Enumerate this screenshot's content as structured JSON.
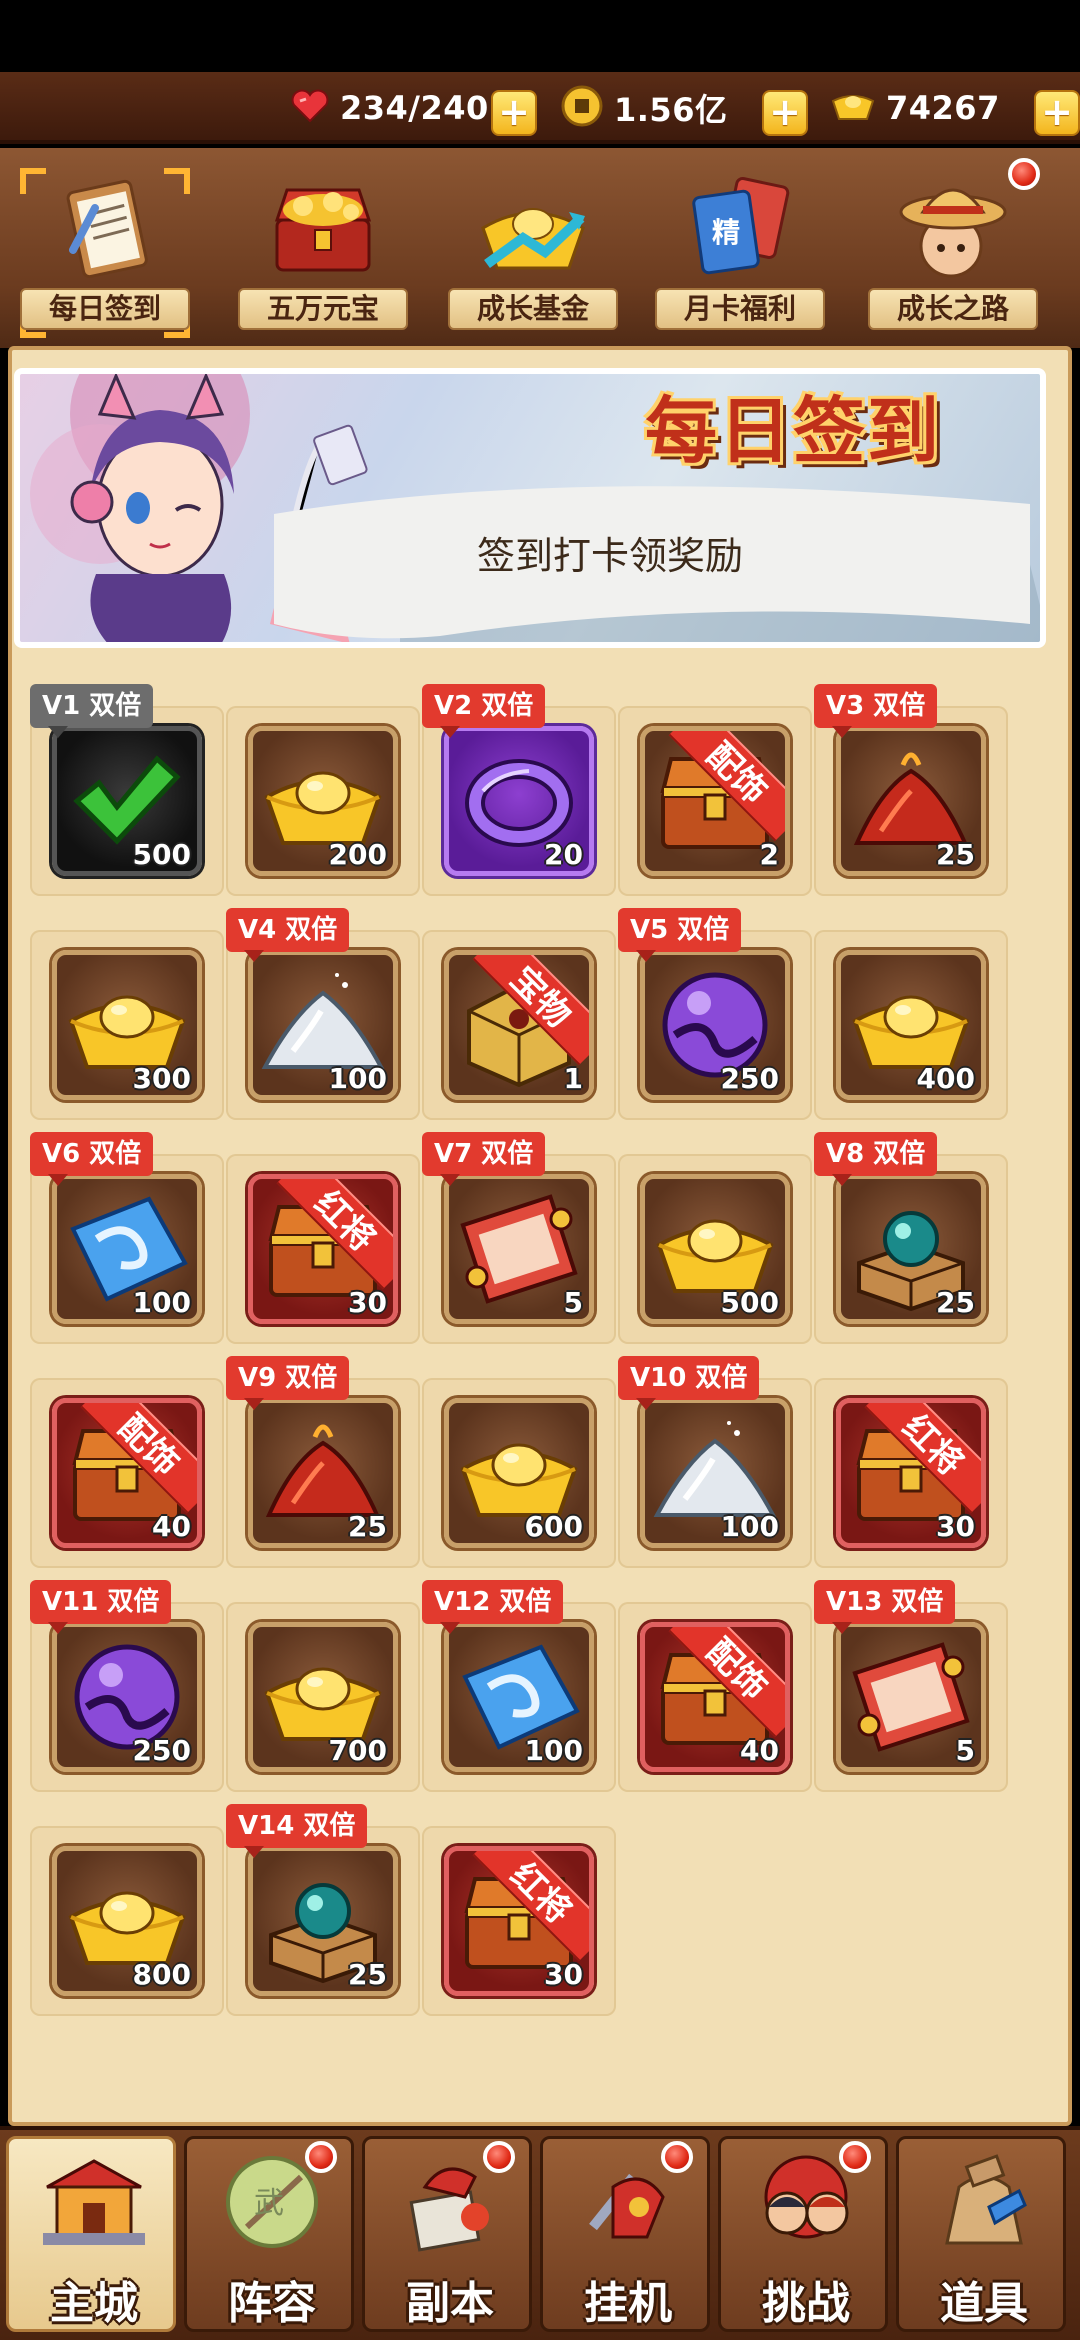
{
  "currency": {
    "stamina": "234/240",
    "coins": "1.56亿",
    "ingots": "74267"
  },
  "tabs": [
    {
      "label": "每日签到",
      "icon": "clipboard-icon",
      "selected": true
    },
    {
      "label": "五万元宝",
      "icon": "treasure-chest-icon"
    },
    {
      "label": "成长基金",
      "icon": "gold-ingot-chart-icon"
    },
    {
      "label": "月卡福利",
      "icon": "month-card-icon"
    },
    {
      "label": "成长之路",
      "icon": "straw-hat-hero-icon",
      "badge": true
    }
  ],
  "banner": {
    "title": "每日签到",
    "subtitle": "签到打卡领奖励"
  },
  "rewards": [
    {
      "vip": "V1 双倍",
      "vip_style": "gray",
      "item": "checkmark",
      "count": "500",
      "frame": "black",
      "claimed": true
    },
    {
      "item": "gold-ingot",
      "count": "200",
      "frame": "brown"
    },
    {
      "vip": "V2 双倍",
      "item": "purple-ring",
      "count": "20",
      "frame": "purple"
    },
    {
      "ribbon": "配饰",
      "item": "treasure-chest",
      "count": "2",
      "frame": "brown"
    },
    {
      "vip": "V3 双倍",
      "item": "red-powder",
      "count": "25",
      "frame": "brown"
    },
    {
      "item": "gold-ingot",
      "count": "300",
      "frame": "brown"
    },
    {
      "vip": "V4 双倍",
      "item": "white-powder",
      "count": "100",
      "frame": "brown"
    },
    {
      "ribbon": "宝物",
      "item": "golden-box",
      "count": "1",
      "frame": "brown"
    },
    {
      "vip": "V5 双倍",
      "item": "purple-orb",
      "count": "250",
      "frame": "brown"
    },
    {
      "item": "gold-ingot",
      "count": "400",
      "frame": "brown"
    },
    {
      "vip": "V6 双倍",
      "item": "blue-crystal",
      "count": "100",
      "frame": "brown"
    },
    {
      "ribbon": "红将",
      "item": "treasure-chest",
      "count": "30",
      "frame": "red"
    },
    {
      "vip": "V7 双倍",
      "item": "red-scroll",
      "count": "5",
      "frame": "brown"
    },
    {
      "item": "gold-ingot",
      "count": "500",
      "frame": "brown"
    },
    {
      "vip": "V8 双倍",
      "item": "green-orb-box",
      "count": "25",
      "frame": "brown"
    },
    {
      "ribbon": "配饰",
      "item": "treasure-chest",
      "count": "40",
      "frame": "red"
    },
    {
      "vip": "V9 双倍",
      "item": "red-powder",
      "count": "25",
      "frame": "brown"
    },
    {
      "item": "gold-ingot",
      "count": "600",
      "frame": "brown"
    },
    {
      "vip": "V10 双倍",
      "item": "white-powder",
      "count": "100",
      "frame": "brown"
    },
    {
      "ribbon": "红将",
      "item": "treasure-chest",
      "count": "30",
      "frame": "red"
    },
    {
      "vip": "V11 双倍",
      "item": "purple-orb",
      "count": "250",
      "frame": "brown"
    },
    {
      "item": "gold-ingot",
      "count": "700",
      "frame": "brown"
    },
    {
      "vip": "V12 双倍",
      "item": "blue-crystal",
      "count": "100",
      "frame": "brown"
    },
    {
      "ribbon": "配饰",
      "item": "treasure-chest",
      "count": "40",
      "frame": "red"
    },
    {
      "vip": "V13 双倍",
      "item": "red-scroll",
      "count": "5",
      "frame": "brown"
    },
    {
      "item": "gold-ingot",
      "count": "800",
      "frame": "brown"
    },
    {
      "vip": "V14 双倍",
      "item": "green-orb-box",
      "count": "25",
      "frame": "brown"
    },
    {
      "ribbon": "红将",
      "item": "treasure-chest",
      "count": "30",
      "frame": "red"
    }
  ],
  "nav": [
    {
      "label": "主城",
      "icon": "palace-icon",
      "active": true
    },
    {
      "label": "阵容",
      "icon": "lineup-icon",
      "badge": true
    },
    {
      "label": "副本",
      "icon": "dungeon-icon",
      "badge": true
    },
    {
      "label": "挂机",
      "icon": "idle-icon",
      "badge": true
    },
    {
      "label": "挑战",
      "icon": "challenge-icon",
      "badge": true
    },
    {
      "label": "道具",
      "icon": "items-bag-icon"
    }
  ]
}
